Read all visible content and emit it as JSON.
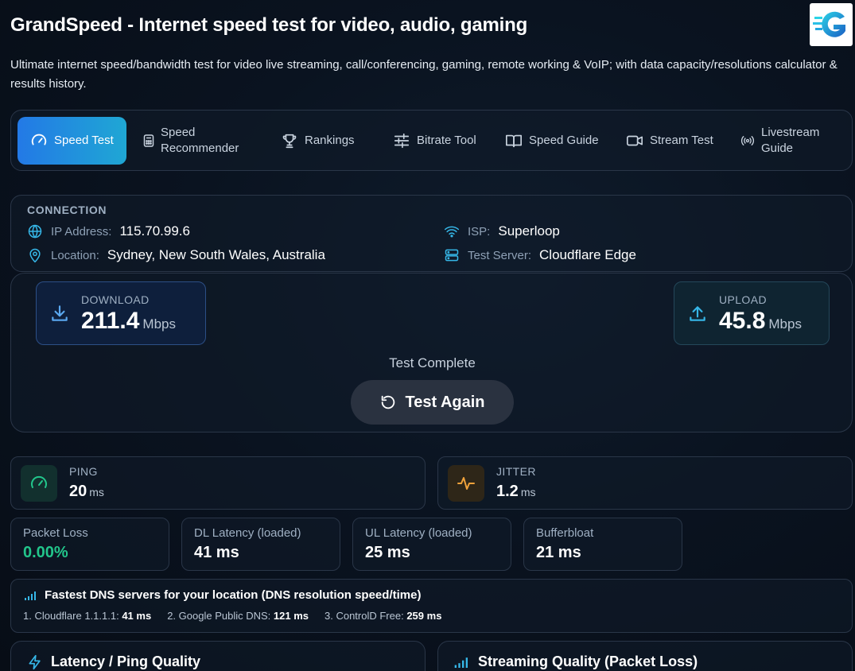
{
  "header": {
    "title": "GrandSpeed - Internet speed test for video, audio, gaming",
    "subtitle": "Ultimate internet speed/bandwidth test for video live streaming, call/conferencing, gaming, remote working & VoIP; with data capacity/resolutions calculator & results history."
  },
  "nav": {
    "items": [
      {
        "label": "Speed Test",
        "icon": "gauge-icon"
      },
      {
        "label": "Speed Recommender",
        "icon": "calculator-icon"
      },
      {
        "label": "Rankings",
        "icon": "trophy-icon"
      },
      {
        "label": "Bitrate Tool",
        "icon": "sliders-icon"
      },
      {
        "label": "Speed Guide",
        "icon": "book-icon"
      },
      {
        "label": "Stream Test",
        "icon": "video-icon"
      },
      {
        "label": "Livestream Guide",
        "icon": "broadcast-icon"
      }
    ],
    "active": "Speed Test"
  },
  "connection": {
    "heading": "CONNECTION",
    "ip_label": "IP Address:",
    "ip_value": "115.70.99.6",
    "isp_label": "ISP:",
    "isp_value": "Superloop",
    "location_label": "Location:",
    "location_value": "Sydney, New South Wales, Australia",
    "server_label": "Test Server:",
    "server_value": "Cloudflare Edge"
  },
  "speed": {
    "download_label": "DOWNLOAD",
    "download_value": "211.4",
    "download_unit": "Mbps",
    "upload_label": "UPLOAD",
    "upload_value": "45.8",
    "upload_unit": "Mbps",
    "status": "Test Complete",
    "again_label": "Test Again"
  },
  "metrics": {
    "ping_label": "PING",
    "ping_value": "20",
    "ping_unit": "ms",
    "jitter_label": "JITTER",
    "jitter_value": "1.2",
    "jitter_unit": "ms"
  },
  "details": {
    "packet_loss_label": "Packet Loss",
    "packet_loss_value": "0.00%",
    "dl_latency_label": "DL Latency (loaded)",
    "dl_latency_value": "41 ms",
    "ul_latency_label": "UL Latency (loaded)",
    "ul_latency_value": "25 ms",
    "bufferbloat_label": "Bufferbloat",
    "bufferbloat_value": "21 ms"
  },
  "dns": {
    "heading": "Fastest DNS servers for your location (DNS resolution speed/time)",
    "servers": [
      {
        "name": "1. Cloudflare 1.1.1.1:",
        "time": "41 ms"
      },
      {
        "name": "2. Google Public DNS:",
        "time": "121 ms"
      },
      {
        "name": "3. ControlD Free:",
        "time": "259 ms"
      }
    ]
  },
  "sections": {
    "latency_title": "Latency / Ping Quality",
    "streaming_title": "Streaming Quality (Packet Loss)"
  },
  "colors": {
    "accent_start": "#2379e6",
    "accent_end": "#1fa7d4",
    "good": "#22c58b",
    "jitter_orange": "#f0a23b",
    "icon_cyan": "#36b7e8"
  }
}
